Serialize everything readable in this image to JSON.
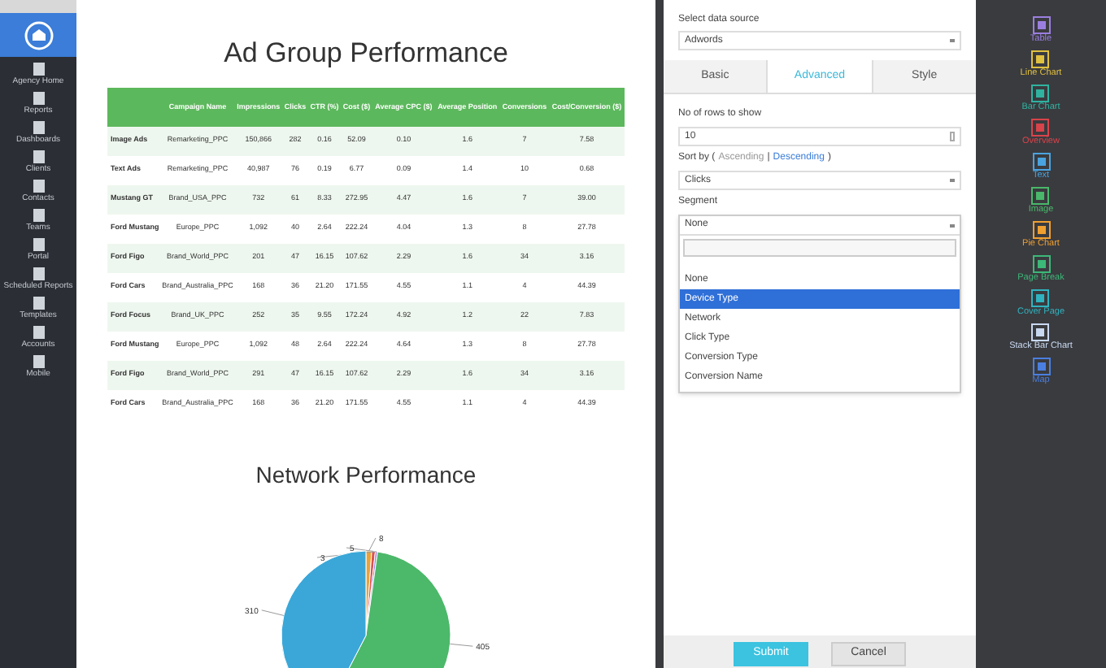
{
  "sidebar": {
    "items": [
      {
        "label": "Agency Home"
      },
      {
        "label": "Reports"
      },
      {
        "label": "Dashboards"
      },
      {
        "label": "Clients"
      },
      {
        "label": "Contacts"
      },
      {
        "label": "Teams"
      },
      {
        "label": "Portal"
      },
      {
        "label": "Scheduled Reports"
      },
      {
        "label": "Templates"
      },
      {
        "label": "Accounts"
      },
      {
        "label": "Mobile"
      }
    ]
  },
  "report": {
    "title": "Ad Group Performance",
    "table": {
      "columns": [
        "",
        "Campaign Name",
        "Impressions",
        "Clicks",
        "CTR (%)",
        "Cost ($)",
        "Average CPC ($)",
        "Average Position",
        "Conversions",
        "Cost/Conversion ($)"
      ],
      "rows": [
        [
          "Image Ads",
          "Remarketing_PPC",
          "150,866",
          "282",
          "0.16",
          "52.09",
          "0.10",
          "1.6",
          "7",
          "7.58"
        ],
        [
          "Text Ads",
          "Remarketing_PPC",
          "40,987",
          "76",
          "0.19",
          "6.77",
          "0.09",
          "1.4",
          "10",
          "0.68"
        ],
        [
          "Mustang GT",
          "Brand_USA_PPC",
          "732",
          "61",
          "8.33",
          "272.95",
          "4.47",
          "1.6",
          "7",
          "39.00"
        ],
        [
          "Ford Mustang",
          "Europe_PPC",
          "1,092",
          "40",
          "2.64",
          "222.24",
          "4.04",
          "1.3",
          "8",
          "27.78"
        ],
        [
          "Ford Figo",
          "Brand_World_PPC",
          "201",
          "47",
          "16.15",
          "107.62",
          "2.29",
          "1.6",
          "34",
          "3.16"
        ],
        [
          "Ford Cars",
          "Brand_Australia_PPC",
          "168",
          "36",
          "21.20",
          "171.55",
          "4.55",
          "1.1",
          "4",
          "44.39"
        ],
        [
          "Ford Focus",
          "Brand_UK_PPC",
          "252",
          "35",
          "9.55",
          "172.24",
          "4.92",
          "1.2",
          "22",
          "7.83"
        ],
        [
          "Ford Mustang",
          "Europe_PPC",
          "1,092",
          "48",
          "2.64",
          "222.24",
          "4.64",
          "1.3",
          "8",
          "27.78"
        ],
        [
          "Ford Figo",
          "Brand_World_PPC",
          "291",
          "47",
          "16.15",
          "107.62",
          "2.29",
          "1.6",
          "34",
          "3.16"
        ],
        [
          "Ford Cars",
          "Brand_Australia_PPC",
          "168",
          "36",
          "21.20",
          "171.55",
          "4.55",
          "1.1",
          "4",
          "44.39"
        ]
      ]
    },
    "chart_data": {
      "type": "pie",
      "title": "Network Performance",
      "values": [
        405,
        310,
        8,
        5,
        3
      ],
      "data_labels": true
    }
  },
  "panel": {
    "data_source_label": "Select data source",
    "data_source": "Adwords",
    "tabs": [
      {
        "label": "Basic",
        "selected": false
      },
      {
        "label": "Advanced",
        "selected": true
      },
      {
        "label": "Style",
        "selected": false
      }
    ],
    "rows_label": "No of rows to show",
    "rows_value": "10",
    "sort_label": "Sort by (",
    "sort_options": [
      {
        "label": "Ascending",
        "selected": false
      },
      {
        "label": "Descending",
        "selected": true
      }
    ],
    "sort_sep": "|",
    "sort_end": ")",
    "sort_value": "Clicks",
    "segment_label": "Segment",
    "segment_value": "None",
    "segment_options": [
      {
        "label": "None",
        "selected": false
      },
      {
        "label": "Device Type",
        "selected": true
      },
      {
        "label": "Network",
        "selected": false
      },
      {
        "label": "Click Type",
        "selected": false
      },
      {
        "label": "Conversion Type",
        "selected": false
      },
      {
        "label": "Conversion Name",
        "selected": false
      }
    ],
    "buttons": [
      "Submit",
      "Cancel"
    ]
  },
  "widgets": [
    {
      "label": "Table",
      "color": "#9b7fe0"
    },
    {
      "label": "Line Chart",
      "color": "#e0c040"
    },
    {
      "label": "Bar Chart",
      "color": "#2fb3a0"
    },
    {
      "label": "Overview",
      "color": "#d9434a"
    },
    {
      "label": "Text",
      "color": "#4aa3df"
    },
    {
      "label": "Image",
      "color": "#49b86a"
    },
    {
      "label": "Pie Chart",
      "color": "#f0a030"
    },
    {
      "label": "Page Break",
      "color": "#3cb878"
    },
    {
      "label": "Cover Page",
      "color": "#2fb3c0"
    },
    {
      "label": "Stack Bar Chart",
      "color": "#c8d8f0"
    },
    {
      "label": "Map",
      "color": "#4a7fe0"
    }
  ]
}
